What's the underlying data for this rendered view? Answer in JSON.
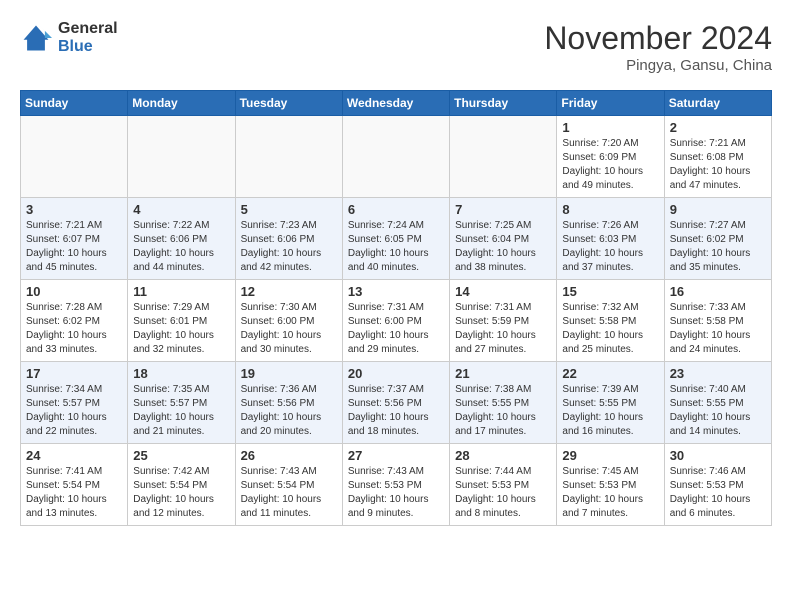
{
  "logo": {
    "general": "General",
    "blue": "Blue"
  },
  "title": "November 2024",
  "location": "Pingya, Gansu, China",
  "days_of_week": [
    "Sunday",
    "Monday",
    "Tuesday",
    "Wednesday",
    "Thursday",
    "Friday",
    "Saturday"
  ],
  "weeks": [
    [
      {
        "day": "",
        "info": ""
      },
      {
        "day": "",
        "info": ""
      },
      {
        "day": "",
        "info": ""
      },
      {
        "day": "",
        "info": ""
      },
      {
        "day": "",
        "info": ""
      },
      {
        "day": "1",
        "info": "Sunrise: 7:20 AM\nSunset: 6:09 PM\nDaylight: 10 hours\nand 49 minutes."
      },
      {
        "day": "2",
        "info": "Sunrise: 7:21 AM\nSunset: 6:08 PM\nDaylight: 10 hours\nand 47 minutes."
      }
    ],
    [
      {
        "day": "3",
        "info": "Sunrise: 7:21 AM\nSunset: 6:07 PM\nDaylight: 10 hours\nand 45 minutes."
      },
      {
        "day": "4",
        "info": "Sunrise: 7:22 AM\nSunset: 6:06 PM\nDaylight: 10 hours\nand 44 minutes."
      },
      {
        "day": "5",
        "info": "Sunrise: 7:23 AM\nSunset: 6:06 PM\nDaylight: 10 hours\nand 42 minutes."
      },
      {
        "day": "6",
        "info": "Sunrise: 7:24 AM\nSunset: 6:05 PM\nDaylight: 10 hours\nand 40 minutes."
      },
      {
        "day": "7",
        "info": "Sunrise: 7:25 AM\nSunset: 6:04 PM\nDaylight: 10 hours\nand 38 minutes."
      },
      {
        "day": "8",
        "info": "Sunrise: 7:26 AM\nSunset: 6:03 PM\nDaylight: 10 hours\nand 37 minutes."
      },
      {
        "day": "9",
        "info": "Sunrise: 7:27 AM\nSunset: 6:02 PM\nDaylight: 10 hours\nand 35 minutes."
      }
    ],
    [
      {
        "day": "10",
        "info": "Sunrise: 7:28 AM\nSunset: 6:02 PM\nDaylight: 10 hours\nand 33 minutes."
      },
      {
        "day": "11",
        "info": "Sunrise: 7:29 AM\nSunset: 6:01 PM\nDaylight: 10 hours\nand 32 minutes."
      },
      {
        "day": "12",
        "info": "Sunrise: 7:30 AM\nSunset: 6:00 PM\nDaylight: 10 hours\nand 30 minutes."
      },
      {
        "day": "13",
        "info": "Sunrise: 7:31 AM\nSunset: 6:00 PM\nDaylight: 10 hours\nand 29 minutes."
      },
      {
        "day": "14",
        "info": "Sunrise: 7:31 AM\nSunset: 5:59 PM\nDaylight: 10 hours\nand 27 minutes."
      },
      {
        "day": "15",
        "info": "Sunrise: 7:32 AM\nSunset: 5:58 PM\nDaylight: 10 hours\nand 25 minutes."
      },
      {
        "day": "16",
        "info": "Sunrise: 7:33 AM\nSunset: 5:58 PM\nDaylight: 10 hours\nand 24 minutes."
      }
    ],
    [
      {
        "day": "17",
        "info": "Sunrise: 7:34 AM\nSunset: 5:57 PM\nDaylight: 10 hours\nand 22 minutes."
      },
      {
        "day": "18",
        "info": "Sunrise: 7:35 AM\nSunset: 5:57 PM\nDaylight: 10 hours\nand 21 minutes."
      },
      {
        "day": "19",
        "info": "Sunrise: 7:36 AM\nSunset: 5:56 PM\nDaylight: 10 hours\nand 20 minutes."
      },
      {
        "day": "20",
        "info": "Sunrise: 7:37 AM\nSunset: 5:56 PM\nDaylight: 10 hours\nand 18 minutes."
      },
      {
        "day": "21",
        "info": "Sunrise: 7:38 AM\nSunset: 5:55 PM\nDaylight: 10 hours\nand 17 minutes."
      },
      {
        "day": "22",
        "info": "Sunrise: 7:39 AM\nSunset: 5:55 PM\nDaylight: 10 hours\nand 16 minutes."
      },
      {
        "day": "23",
        "info": "Sunrise: 7:40 AM\nSunset: 5:55 PM\nDaylight: 10 hours\nand 14 minutes."
      }
    ],
    [
      {
        "day": "24",
        "info": "Sunrise: 7:41 AM\nSunset: 5:54 PM\nDaylight: 10 hours\nand 13 minutes."
      },
      {
        "day": "25",
        "info": "Sunrise: 7:42 AM\nSunset: 5:54 PM\nDaylight: 10 hours\nand 12 minutes."
      },
      {
        "day": "26",
        "info": "Sunrise: 7:43 AM\nSunset: 5:54 PM\nDaylight: 10 hours\nand 11 minutes."
      },
      {
        "day": "27",
        "info": "Sunrise: 7:43 AM\nSunset: 5:53 PM\nDaylight: 10 hours\nand 9 minutes."
      },
      {
        "day": "28",
        "info": "Sunrise: 7:44 AM\nSunset: 5:53 PM\nDaylight: 10 hours\nand 8 minutes."
      },
      {
        "day": "29",
        "info": "Sunrise: 7:45 AM\nSunset: 5:53 PM\nDaylight: 10 hours\nand 7 minutes."
      },
      {
        "day": "30",
        "info": "Sunrise: 7:46 AM\nSunset: 5:53 PM\nDaylight: 10 hours\nand 6 minutes."
      }
    ]
  ]
}
